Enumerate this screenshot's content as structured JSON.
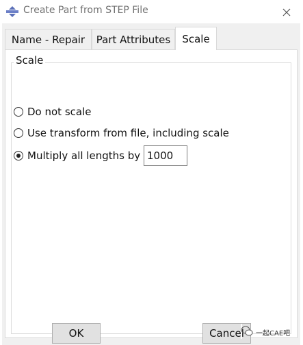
{
  "window": {
    "title": "Create Part from STEP File",
    "close_icon": "close-icon",
    "app_icon": "abaqus-icon"
  },
  "tabs": [
    {
      "label": "Name - Repair",
      "selected": false
    },
    {
      "label": "Part Attributes",
      "selected": false
    },
    {
      "label": "Scale",
      "selected": true
    }
  ],
  "scale_group": {
    "label": "Scale",
    "options": [
      {
        "label": "Do not scale",
        "selected": false
      },
      {
        "label": "Use transform from file, including scale",
        "selected": false
      },
      {
        "label": "Multiply all lengths by",
        "selected": true
      }
    ],
    "multiply_value": "1000"
  },
  "buttons": {
    "ok_label": "OK",
    "cancel_label": "Cancel"
  },
  "watermark": {
    "text": "一起CAE吧"
  },
  "colors": {
    "background": "#f0f0f0",
    "panel": "#ffffff",
    "title_text": "#707070",
    "app_icon": "#5a6fb8"
  }
}
